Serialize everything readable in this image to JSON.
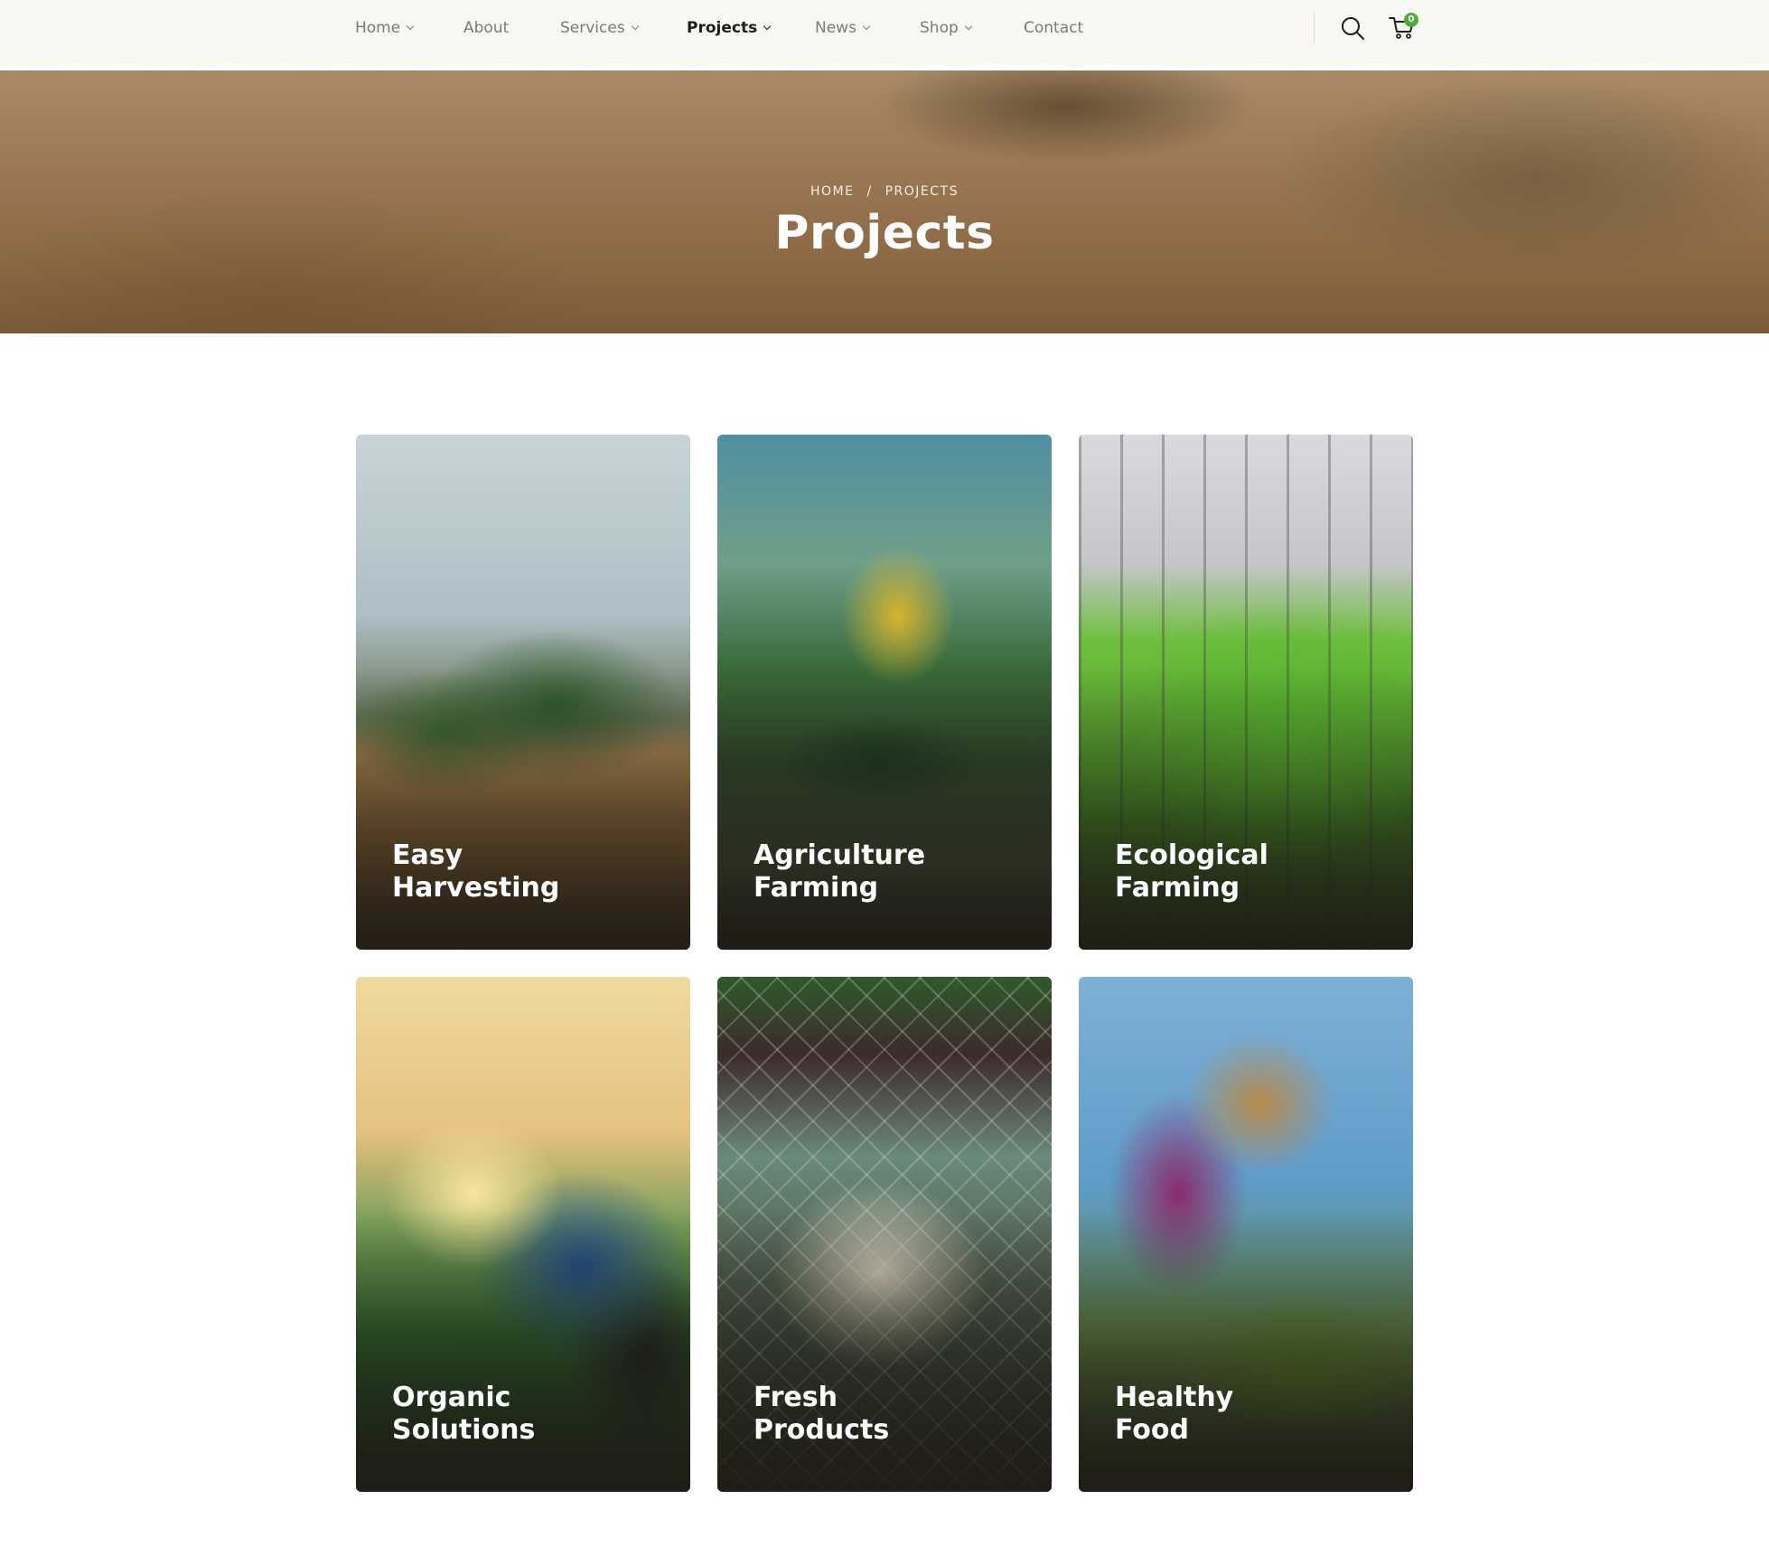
{
  "nav": {
    "items": [
      {
        "label": "Home",
        "dropdown": true,
        "active": false
      },
      {
        "label": "About",
        "dropdown": false,
        "active": false
      },
      {
        "label": "Services",
        "dropdown": true,
        "active": false
      },
      {
        "label": "Projects",
        "dropdown": true,
        "active": true
      },
      {
        "label": "News",
        "dropdown": true,
        "active": false
      },
      {
        "label": "Shop",
        "dropdown": true,
        "active": false
      },
      {
        "label": "Contact",
        "dropdown": false,
        "active": false
      }
    ],
    "cart_count": "0",
    "search_icon": "search-icon",
    "cart_icon": "cart-icon",
    "accent_color": "#4caf33"
  },
  "banner": {
    "breadcrumb_home": "HOME",
    "breadcrumb_separator": "/",
    "breadcrumb_current": "PROJECTS",
    "title": "Projects"
  },
  "projects": [
    {
      "title_line1": "Easy",
      "title_line2": "Harvesting"
    },
    {
      "title_line1": "Agriculture",
      "title_line2": "Farming"
    },
    {
      "title_line1": "Ecological",
      "title_line2": "Farming"
    },
    {
      "title_line1": "Organic",
      "title_line2": "Solutions"
    },
    {
      "title_line1": "Fresh",
      "title_line2": "Products"
    },
    {
      "title_line1": "Healthy",
      "title_line2": "Food"
    }
  ]
}
